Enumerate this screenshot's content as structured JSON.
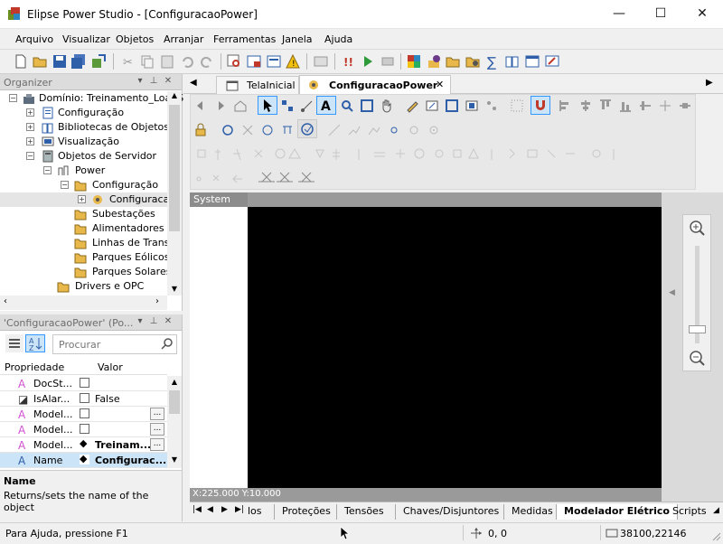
{
  "window": {
    "title": "Elipse Power Studio - [ConfiguracaoPower]",
    "minimize_glyph": "—",
    "maximize_glyph": "☐",
    "close_glyph": "✕"
  },
  "menu": [
    "Arquivo",
    "Visualizar",
    "Objetos",
    "Arranjar",
    "Ferramentas",
    "Janela",
    "Ajuda"
  ],
  "organizer": {
    "title": "Organizer",
    "tree": [
      {
        "label": "Domínio: Treinamento_LoadS",
        "icon": "domain-icon"
      },
      {
        "label": "Configuração",
        "icon": "config-icon"
      },
      {
        "label": "Bibliotecas de Objetos",
        "icon": "library-icon"
      },
      {
        "label": "Visualização",
        "icon": "screen-icon"
      },
      {
        "label": "Objetos de Servidor",
        "icon": "server-icon"
      },
      {
        "label": "Power",
        "icon": "power-icon"
      },
      {
        "label": "Configuração",
        "icon": "folder-icon"
      },
      {
        "label": "Configuracao",
        "icon": "power-config-icon"
      },
      {
        "label": "Subestações",
        "icon": "folder-icon"
      },
      {
        "label": "Alimentadores",
        "icon": "folder-icon"
      },
      {
        "label": "Linhas de Transm",
        "icon": "folder-icon"
      },
      {
        "label": "Parques Eólicos",
        "icon": "folder-icon"
      },
      {
        "label": "Parques Solares",
        "icon": "folder-icon"
      },
      {
        "label": "Drivers e OPC",
        "icon": "folder-icon"
      }
    ]
  },
  "properties": {
    "title": "'ConfiguracaoPower' (Po...",
    "search_placeholder": "Procurar",
    "col_name": "Propriedade",
    "col_value": "Valor",
    "rows": [
      {
        "name": "DocSt...",
        "value": ""
      },
      {
        "name": "IsAlar...",
        "value": "False"
      },
      {
        "name": "Model...",
        "value": ""
      },
      {
        "name": "Model...",
        "value": ""
      },
      {
        "name": "Model...",
        "value": "Treinam..."
      },
      {
        "name": "Name",
        "value": "Configurac..."
      }
    ],
    "desc_title": "Name",
    "desc_text": "Returns/sets the name of the object"
  },
  "doc_tabs": [
    {
      "label": "TelaInicial"
    },
    {
      "label": "ConfiguracaoPower"
    }
  ],
  "canvas": {
    "layer_label": "System",
    "coords": "X:225.000 Y:10.000"
  },
  "bottom_tabs": [
    "los",
    "Proteções",
    "Tensões",
    "Chaves/Disjuntores",
    "Medidas",
    "Modelador Elétrico",
    "Scripts"
  ],
  "status": {
    "help": "Para Ajuda, pressione F1",
    "pos": "0, 0",
    "size": "38100,22146"
  },
  "colors": {
    "canvas": "#000000",
    "selection": "#cce4f7",
    "accent": "#3399ff"
  }
}
